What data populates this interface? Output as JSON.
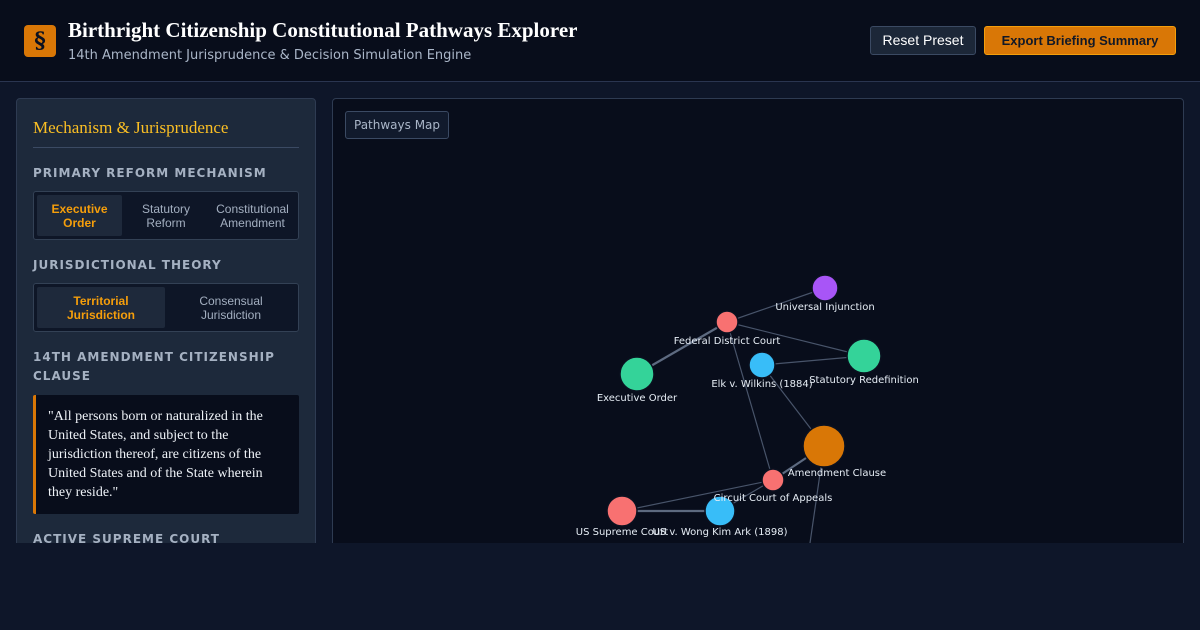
{
  "header": {
    "logo_glyph": "§",
    "title": "Birthright Citizenship Constitutional Pathways Explorer",
    "subtitle": "14th Amendment Jurisprudence & Decision Simulation Engine",
    "reset_label": "Reset Preset",
    "export_label": "Export Briefing Summary"
  },
  "sidebar": {
    "title": "Mechanism & Jurisprudence",
    "mechanism": {
      "label": "PRIMARY REFORM MECHANISM",
      "options": [
        {
          "line1": "Executive",
          "line2": "Order",
          "active": true
        },
        {
          "line1": "Statutory",
          "line2": "Reform",
          "active": false
        },
        {
          "line1": "Constitutional",
          "line2": "Amendment",
          "active": false
        }
      ]
    },
    "theory": {
      "label": "JURISDICTIONAL THEORY",
      "options": [
        {
          "line1": "Territorial",
          "line2": "Jurisdiction",
          "active": true
        },
        {
          "line1": "Consensual",
          "line2": "Jurisdiction",
          "active": false
        }
      ]
    },
    "clause": {
      "label": "14TH AMENDMENT CITIZENSHIP CLAUSE",
      "text": "\"All persons born or naturalized in the United States, and subject to the jurisdiction thereof, are citizens of the United States and of the State wherein they reside.\""
    },
    "court": {
      "label": "ACTIVE SUPREME COURT"
    }
  },
  "map": {
    "tag": "Pathways Map",
    "nodes": [
      {
        "id": "universal-injunction",
        "label": "Universal Injunction",
        "color": "#a855f7"
      },
      {
        "id": "federal-district-court",
        "label": "Federal District Court",
        "color": "#f87171"
      },
      {
        "id": "statutory-redefinition",
        "label": "Statutory Redefinition",
        "color": "#34d399"
      },
      {
        "id": "elk-v-wilkins",
        "label": "Elk v. Wilkins (1884)",
        "color": "#38bdf8"
      },
      {
        "id": "executive-order",
        "label": "Executive Order",
        "color": "#34d399"
      },
      {
        "id": "amendment-clause",
        "label": "Amendment Clause",
        "color": "#d97706"
      },
      {
        "id": "circuit-court",
        "label": "Circuit Court of Appeals",
        "color": "#f87171"
      },
      {
        "id": "us-supreme-court",
        "label": "US Supreme Court",
        "color": "#f87171"
      },
      {
        "id": "wong-kim-ark",
        "label": "US v. Wong Kim Ark (1898)",
        "color": "#38bdf8"
      },
      {
        "id": "partial-node",
        "label": "",
        "color": "#38bdf8"
      }
    ],
    "edges": [
      [
        "federal-district-court",
        "universal-injunction"
      ],
      [
        "federal-district-court",
        "statutory-redefinition"
      ],
      [
        "federal-district-court",
        "executive-order"
      ],
      [
        "federal-district-court",
        "circuit-court"
      ],
      [
        "elk-v-wilkins",
        "statutory-redefinition"
      ],
      [
        "elk-v-wilkins",
        "amendment-clause"
      ],
      [
        "amendment-clause",
        "circuit-court"
      ],
      [
        "amendment-clause",
        "partial-node"
      ],
      [
        "circuit-court",
        "us-supreme-court"
      ],
      [
        "circuit-court",
        "wong-kim-ark"
      ],
      [
        "us-supreme-court",
        "wong-kim-ark"
      ]
    ]
  }
}
